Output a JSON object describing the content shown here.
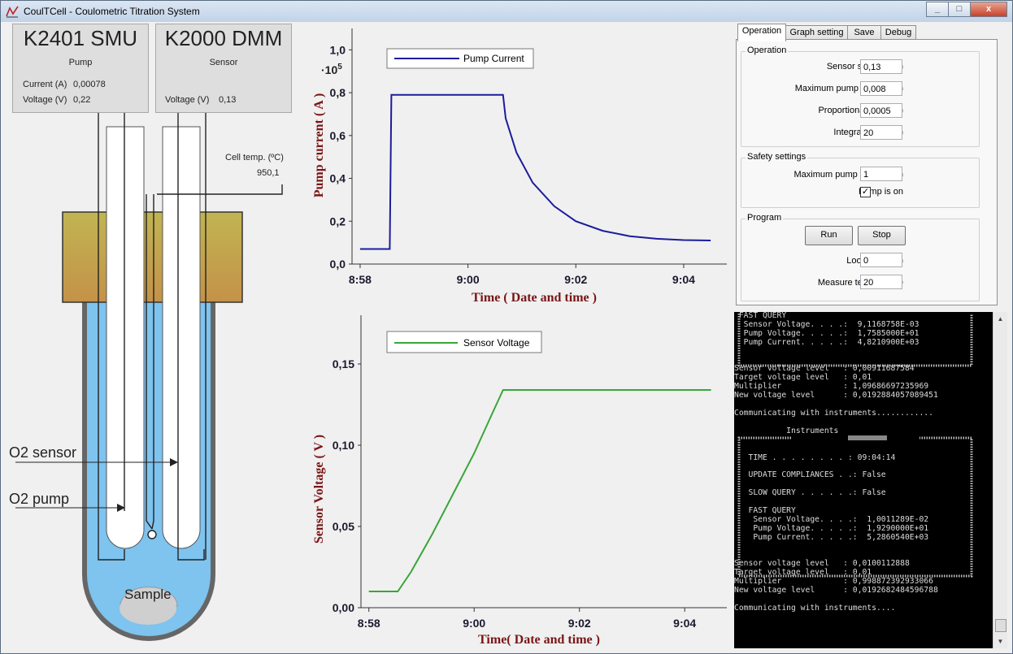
{
  "window": {
    "title": "CoulTCell - Coulometric Titration System",
    "min_label": "_",
    "max_label": "□",
    "close_label": "x"
  },
  "instruments": {
    "smu": {
      "name": "K2401 SMU",
      "role": "Pump",
      "current_label": "Current (A)",
      "current_value": "0,00078",
      "voltage_label": "Voltage (V)",
      "voltage_value": "0,22"
    },
    "dmm": {
      "name": "K2000 DMM",
      "role": "Sensor",
      "voltage_label": "Voltage (V)",
      "voltage_value": "0,13"
    }
  },
  "cell": {
    "temp_label": "Cell temp. (ºC)",
    "temp_value": "950,1",
    "sensor_label": "O2 sensor",
    "pump_label": "O2 pump",
    "sample_label": "Sample"
  },
  "graphs": {
    "pump": {
      "ylabel": "Pump current ( A )",
      "xlabel": "Time ( Date and time )",
      "legend": "Pump Current",
      "multiplier": "·10",
      "multiplier_exp": "5",
      "yticks": [
        "0,0",
        "0,2",
        "0,4",
        "0,6",
        "0,8",
        "1,0"
      ],
      "xticks": [
        "8:58",
        "9:00",
        "9:02",
        "9:04"
      ],
      "line_color": "#1c1c9c"
    },
    "sensor": {
      "ylabel": "Sensor Voltage ( V )",
      "xlabel": "Time( Date and time )",
      "legend": "Sensor Voltage",
      "yticks": [
        "0,00",
        "0,05",
        "0,10",
        "0,15"
      ],
      "xticks": [
        "8:58",
        "9:00",
        "9:02",
        "9:04"
      ],
      "line_color": "#3aa53a"
    }
  },
  "chart_data": [
    {
      "type": "line",
      "xlabel": "Time ( Date and time )",
      "ylabel": "Pump current ( A )",
      "x_unit": "minutes after 8:58",
      "x": [
        0,
        0.55,
        0.58,
        2.65,
        2.7,
        2.9,
        3.2,
        3.6,
        4.0,
        4.5,
        5.0,
        5.5,
        6.0,
        6.5
      ],
      "series": [
        {
          "name": "Pump Current",
          "values": [
            0.07,
            0.07,
            0.79,
            0.79,
            0.68,
            0.52,
            0.38,
            0.27,
            0.2,
            0.155,
            0.13,
            0.118,
            0.112,
            0.11
          ]
        }
      ],
      "ylim": [
        0,
        1.1
      ],
      "xlim": [
        -0.15,
        6.8
      ],
      "y_scale_note": "·10^5",
      "legend_position": "top-left"
    },
    {
      "type": "line",
      "xlabel": "Time( Date and time )",
      "ylabel": "Sensor Voltage ( V )",
      "x": [
        0,
        0.55,
        0.8,
        1.2,
        1.6,
        2.0,
        2.35,
        2.55,
        6.5
      ],
      "series": [
        {
          "name": "Sensor Voltage",
          "values": [
            0.01,
            0.01,
            0.022,
            0.045,
            0.07,
            0.095,
            0.12,
            0.134,
            0.134
          ]
        }
      ],
      "ylim": [
        0,
        0.18
      ],
      "xlim": [
        -0.15,
        6.8
      ],
      "legend_position": "top-left"
    }
  ],
  "tabs": [
    "Operation",
    "Graph setting",
    "Save",
    "Debug"
  ],
  "operation": {
    "group_title": "Operation",
    "sensor_setpoint_label": "Sensor setpoint (V)",
    "sensor_setpoint": "0,13",
    "max_pump_current_label": "Maximum pump current (A)",
    "max_pump_current": "0,008",
    "prop_band_label": "Proportional band (V)",
    "prop_band": "0,0005",
    "integral_length_label": "Integral length (s)",
    "integral_length": "20"
  },
  "safety": {
    "group_title": "Safety settings",
    "max_pump_voltage_label": "Maximum pump voltage (V)",
    "max_pump_voltage": "1",
    "pump_on_label": "Pump is on",
    "pump_on_mark": "✓"
  },
  "program": {
    "group_title": "Program",
    "run_label": "Run",
    "stop_label": "Stop",
    "loop_delay_label": "Loop delay (s)",
    "loop_delay": "0",
    "measure_temp_label": "Measure temperature",
    "measure_temp": "20"
  },
  "console": {
    "lines": [
      " FAST QUERY",
      "  Sensor Voltage. . . .:  9,1168758E-03",
      "  Pump Voltage. . . . .:  1,7585000E+01",
      "  Pump Current. . . . .:  4,8210900E+03",
      "",
      "",
      "Sensor voltage level   : 0,00911687584",
      "Target voltage level   : 0,01",
      "Multiplier             : 1,09686697235969",
      "New voltage level      : 0,0192884057089451",
      "",
      "Communicating with instruments............",
      "",
      "           Instruments",
      "",
      "",
      "   TIME . . . . . . . . : 09:04:14",
      "",
      "   UPDATE COMPLIANCES . .: False",
      "",
      "   SLOW QUERY . . . . . .: False",
      "",
      "   FAST QUERY",
      "    Sensor Voltage. . . .:  1,0011289E-02",
      "    Pump Voltage. . . . .:  1,9290000E+01",
      "    Pump Current. . . . .:  5,2860540E+03",
      "",
      "",
      "Sensor voltage level   : 0,0100112888",
      "Target voltage level   : 0,01",
      "Multiplier             : 0,998872392933066",
      "New voltage level      : 0,0192682484596788",
      "",
      "Communicating with instruments...."
    ]
  }
}
